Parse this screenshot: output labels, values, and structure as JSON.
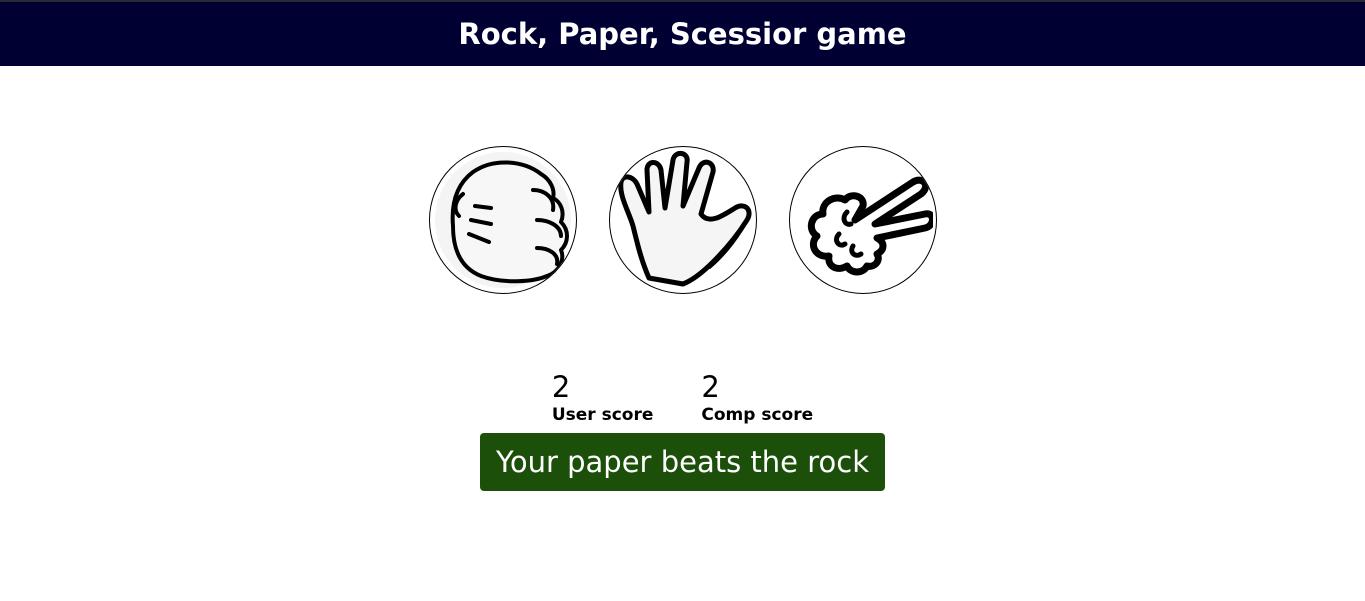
{
  "header": {
    "title": "Rock, Paper, Scessior game"
  },
  "choices": [
    {
      "id": "rock",
      "icon": "rock-fist-icon"
    },
    {
      "id": "paper",
      "icon": "paper-hand-icon"
    },
    {
      "id": "scissors",
      "icon": "scissors-hand-icon"
    }
  ],
  "scores": {
    "user_value": "2",
    "user_label": "User score",
    "comp_value": "2",
    "comp_label": "Comp score"
  },
  "message": {
    "text": "Your paper beats the rock",
    "color": "#1b4f0a"
  },
  "colors": {
    "header_bg": "#000033"
  }
}
